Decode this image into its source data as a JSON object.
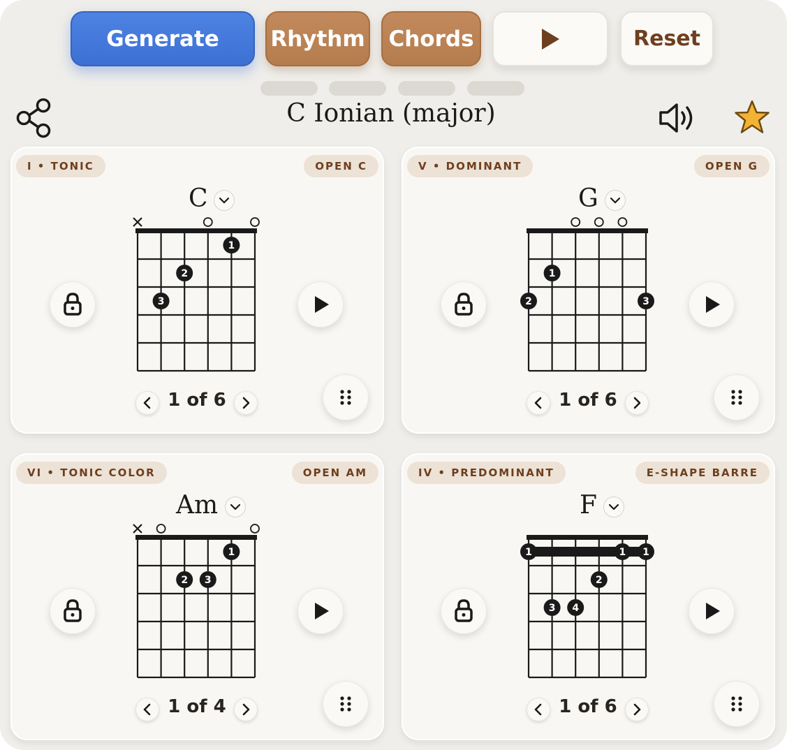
{
  "toolbar": {
    "generate_label": "Generate",
    "rhythm_label": "Rhythm",
    "chords_label": "Chords",
    "reset_label": "Reset"
  },
  "header": {
    "title": "C Ionian (major)"
  },
  "icons": {
    "share": "share-icon",
    "speaker": "speaker-icon",
    "favorite": "star-icon",
    "play": "play-icon",
    "lock": "lock-icon",
    "drag": "drag-handle-icon",
    "prev": "chevron-left-icon",
    "next": "chevron-right-icon",
    "dropdown": "chevron-down-icon"
  },
  "colors": {
    "primary": "#3d70d4",
    "accent": "#b57c4e",
    "tag_bg": "#ede2d6",
    "tag_text": "#6e3f1f",
    "star": "#f2b233"
  },
  "cards": [
    {
      "function_label": "I • TONIC",
      "voicing_label": "OPEN C",
      "chord": "C",
      "pager": "1 of 6",
      "strings_top": [
        "x",
        "",
        "",
        "o",
        "",
        "o"
      ],
      "barre": null,
      "dots": [
        {
          "string": 5,
          "fret": 1,
          "finger": "1"
        },
        {
          "string": 3,
          "fret": 2,
          "finger": "2"
        },
        {
          "string": 2,
          "fret": 3,
          "finger": "3"
        }
      ]
    },
    {
      "function_label": "V • DOMINANT",
      "voicing_label": "OPEN G",
      "chord": "G",
      "pager": "1 of 6",
      "strings_top": [
        "",
        "",
        "o",
        "o",
        "o",
        ""
      ],
      "barre": null,
      "dots": [
        {
          "string": 2,
          "fret": 2,
          "finger": "1"
        },
        {
          "string": 1,
          "fret": 3,
          "finger": "2"
        },
        {
          "string": 6,
          "fret": 3,
          "finger": "3"
        }
      ]
    },
    {
      "function_label": "VI • TONIC COLOR",
      "voicing_label": "OPEN AM",
      "chord": "Am",
      "pager": "1 of 4",
      "strings_top": [
        "x",
        "o",
        "",
        "",
        "",
        "o"
      ],
      "barre": null,
      "dots": [
        {
          "string": 5,
          "fret": 1,
          "finger": "1"
        },
        {
          "string": 3,
          "fret": 2,
          "finger": "2"
        },
        {
          "string": 4,
          "fret": 2,
          "finger": "3"
        }
      ]
    },
    {
      "function_label": "IV • PREDOMINANT",
      "voicing_label": "E-SHAPE BARRE",
      "chord": "F",
      "pager": "1 of 6",
      "strings_top": [
        "",
        "",
        "",
        "",
        "",
        ""
      ],
      "barre": {
        "fret": 1,
        "from_string": 1,
        "to_string": 6,
        "fingers": [
          "1",
          "1",
          "1"
        ]
      },
      "dots": [
        {
          "string": 4,
          "fret": 2,
          "finger": "2"
        },
        {
          "string": 2,
          "fret": 3,
          "finger": "3"
        },
        {
          "string": 3,
          "fret": 3,
          "finger": "4"
        }
      ]
    }
  ]
}
